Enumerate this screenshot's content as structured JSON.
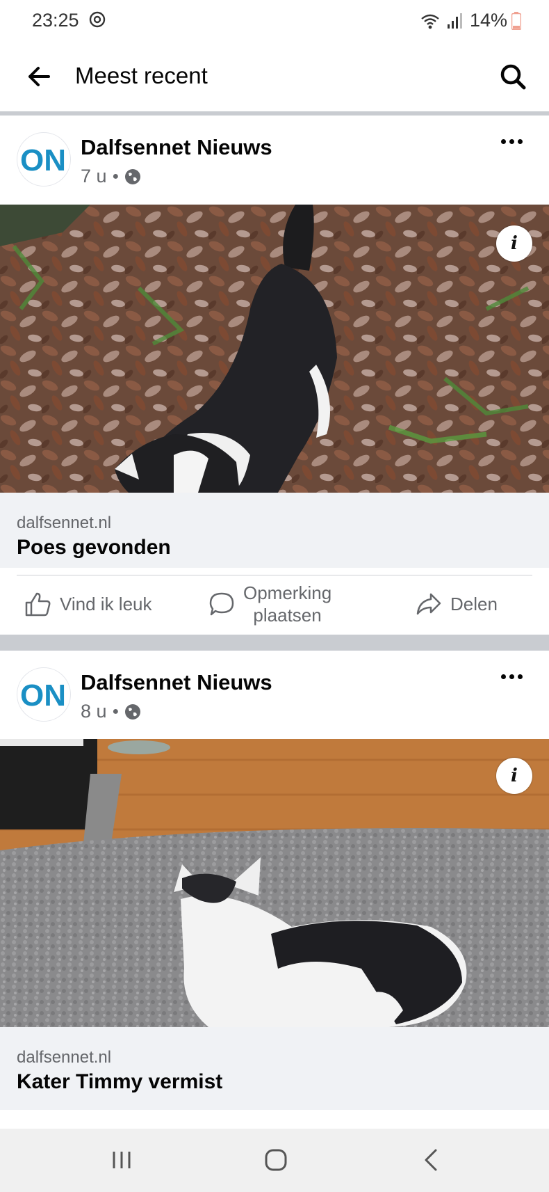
{
  "status_bar": {
    "time": "23:25",
    "battery": "14%",
    "icons": [
      "sync-icon",
      "wifi-icon",
      "signal-icon",
      "battery-low-icon"
    ]
  },
  "app_bar": {
    "title": "Meest recent",
    "back_icon": "arrow-left-icon",
    "search_icon": "search-icon"
  },
  "posts": [
    {
      "author": "Dalfsennet Nieuws",
      "avatar_text": "ON",
      "time": "7 u",
      "visibility_icon": "globe-icon",
      "photo_description_icon": "info-icon",
      "link": {
        "domain": "dalfsennet.nl",
        "title": "Poes gevonden"
      },
      "actions": {
        "like": "Vind ik leuk",
        "comment_line1": "Opmerking",
        "comment_line2": "plaatsen",
        "share": "Delen"
      }
    },
    {
      "author": "Dalfsennet Nieuws",
      "avatar_text": "ON",
      "time": "8 u",
      "visibility_icon": "globe-icon",
      "photo_description_icon": "info-icon",
      "link": {
        "domain": "dalfsennet.nl",
        "title": "Kater Timmy vermist"
      }
    }
  ],
  "nav_bar": {
    "icons": [
      "recent-apps-icon",
      "home-icon",
      "back-icon"
    ]
  },
  "colors": {
    "brand_blue": "#1a8fc4",
    "text_primary": "#050505",
    "text_secondary": "#65676b",
    "link_box_bg": "#f0f2f5",
    "separator": "#c9ccd1"
  }
}
